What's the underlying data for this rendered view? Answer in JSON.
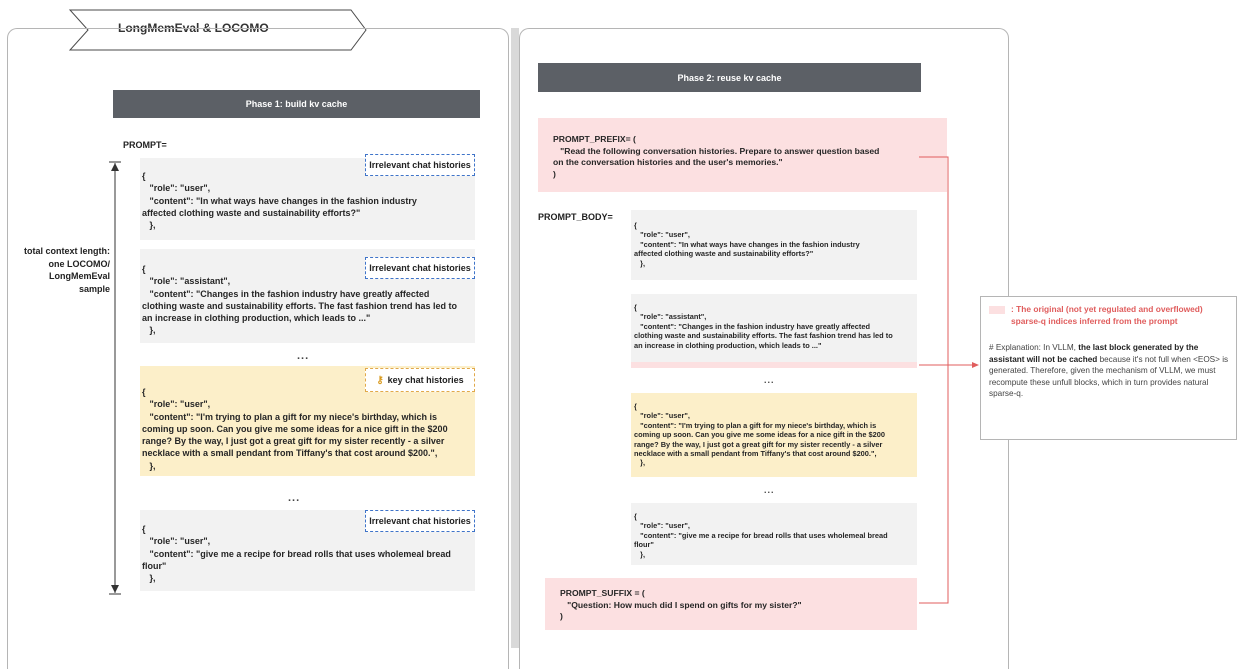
{
  "title": "LongMemEval & LOCOMO",
  "left": {
    "phase_label": "Phase 1: build kv cache",
    "prompt_label": "PROMPT=",
    "context_label": "total context length:\none LOCOMO/\nLongMemEval\nsample",
    "tag_irrelevant": "Irrelevant chat histories",
    "tag_key": "key chat histories",
    "messages": [
      "{\n   \"role\": \"user\",\n   \"content\": \"In what ways have changes in the fashion industry\naffected clothing waste and sustainability efforts?\"\n   },",
      "{\n   \"role\": \"assistant\",\n   \"content\": \"Changes in the fashion industry have greatly affected\nclothing waste and sustainability efforts. The fast fashion trend has led to\nan increase in clothing production, which leads to ...\"\n   },",
      "{\n   \"role\": \"user\",\n   \"content\": \"I'm trying to plan a gift for my niece's birthday, which is\ncoming up soon. Can you give me some ideas for a nice gift in the $200\nrange? By the way, I just got a great gift for my sister recently - a silver\nnecklace with a small pendant from Tiffany's that cost around $200.\",\n   },",
      "{\n   \"role\": \"user\",\n   \"content\": \"give me a recipe for bread rolls that uses wholemeal bread\nflour\"\n   },"
    ],
    "ellipsis": "..."
  },
  "right": {
    "phase_label": "Phase 2: reuse kv cache",
    "prefix": "PROMPT_PREFIX= (\n   \"Read the following conversation histories. Prepare to answer question based\non the conversation histories and the user's memories.\"\n)",
    "body_label": "PROMPT_BODY=",
    "messages": [
      "{\n   \"role\": \"user\",\n   \"content\": \"In what ways have changes in the fashion industry\naffected clothing waste and sustainability efforts?\"\n   },",
      "{\n   \"role\": \"assistant\",\n   \"content\": \"Changes in the fashion industry have greatly affected\nclothing waste and sustainability efforts. The fast fashion trend has led to\nan increase in clothing production, which leads to ...\"",
      "{\n   \"role\": \"user\",\n   \"content\": \"I'm trying to plan a gift for my niece's birthday, which is\ncoming up soon. Can you give me some ideas for a nice gift in the $200\nrange? By the way, I just got a great gift for my sister recently - a silver\nnecklace with a small pendant from Tiffany's that cost around $200.\",\n   },",
      "{\n   \"role\": \"user\",\n   \"content\": \"give me a recipe for bread rolls that uses wholemeal bread\nflour\"\n   },"
    ],
    "ellipsis": "...",
    "suffix": "PROMPT_SUFFIX = (\n   \"Question: How much did I spend on gifts for my sister?\"\n)"
  },
  "note": {
    "legend": ": The original (not yet regulated and overflowed)\nsparse-q indices inferred from the prompt",
    "text_pre": "# Explanation: In VLLM, ",
    "text_bold": "the last block generated by the assistant will not be cached",
    "text_post": " because it's not full when <EOS> is generated. Therefore, given the mechanism of VLLM, we must recompute these unfull blocks, which in turn provides natural sparse-q."
  },
  "colors": {
    "gray": "#f2f2f2",
    "key_yellow": "#fcefc9",
    "sparse_pink": "#fce0e1",
    "accent_red": "#e05d5d",
    "dash_blue": "#3f74c9",
    "dash_orange": "#e1a94a",
    "phase_bar": "#5c6066"
  },
  "icons": {
    "key": "key-icon",
    "arrow": "arrow-right-icon"
  }
}
